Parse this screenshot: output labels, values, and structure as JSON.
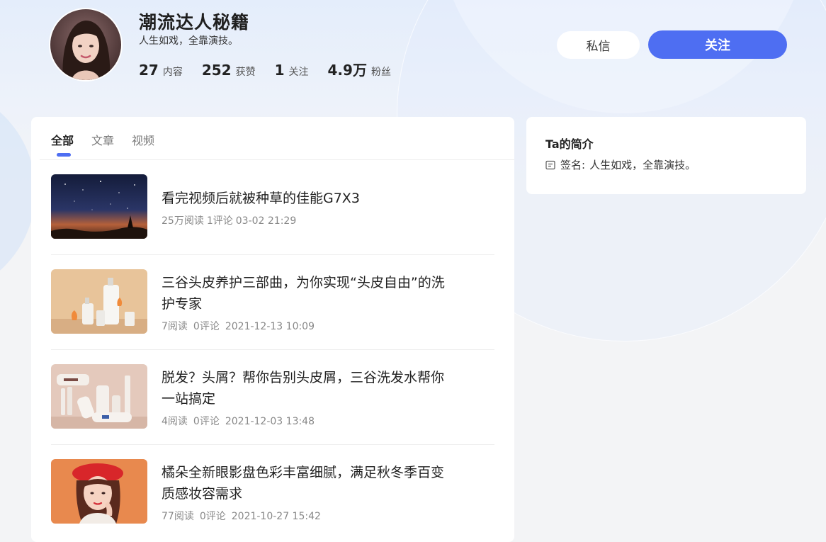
{
  "profile": {
    "name": "潮流达人秘籍",
    "bio": "人生如戏，全靠演技。",
    "stats": [
      {
        "value": "27",
        "label": "内容"
      },
      {
        "value": "252",
        "label": "获赞"
      },
      {
        "value": "1",
        "label": "关注"
      },
      {
        "value": "4.9万",
        "label": "粉丝"
      }
    ],
    "message_button": "私信",
    "follow_button": "关注"
  },
  "tabs": [
    {
      "label": "全部",
      "active": true
    },
    {
      "label": "文章",
      "active": false
    },
    {
      "label": "视频",
      "active": false
    }
  ],
  "feed": [
    {
      "title": "看完视频后就被种草的佳能G7X3",
      "reads": "25万阅读",
      "comments": "1评论",
      "date": "03-02 21:29",
      "thumb_icon": "night-sky-image"
    },
    {
      "title": "三谷头皮养护三部曲，为你实现“头皮自由”的洗护专家",
      "reads": "7阅读",
      "comments": "0评论",
      "date": "2021-12-13 10:09",
      "thumb_icon": "shampoo-bottles-image"
    },
    {
      "title": "脱发？头屑？帮你告别头皮屑，三谷洗发水帮你一站搞定",
      "reads": "4阅读",
      "comments": "0评论",
      "date": "2021-12-03 13:48",
      "thumb_icon": "product-set-image"
    },
    {
      "title": "橘朵全新眼影盘色彩丰富细腻，满足秋冬季百变质感妆容需求",
      "reads": "77阅读",
      "comments": "0评论",
      "date": "2021-10-27 15:42",
      "thumb_icon": "model-portrait-image"
    }
  ],
  "intro": {
    "title": "Ta的简介",
    "sign_label": "签名:",
    "sign_text": "人生如戏，全靠演技。"
  },
  "colors": {
    "accent": "#4e6ef2",
    "page_bg": "#f3f4f6",
    "card_bg": "#ffffff"
  }
}
